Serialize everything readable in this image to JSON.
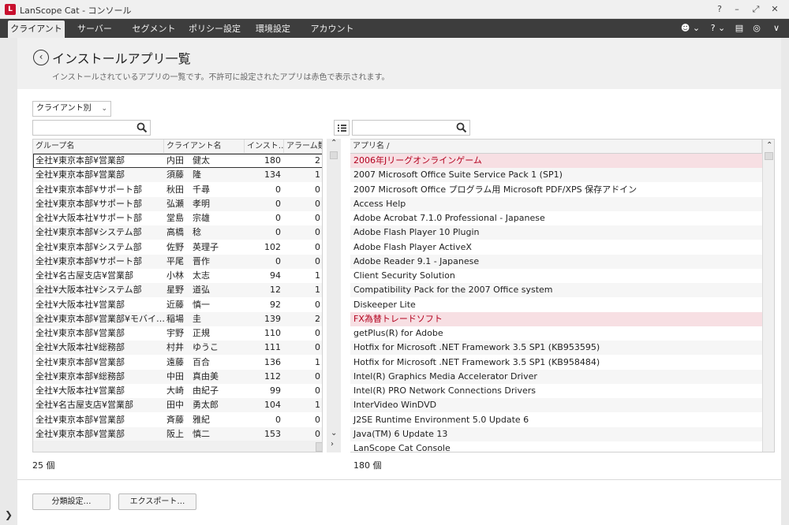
{
  "window": {
    "title": "LanScope Cat - コンソール",
    "icon_label": "L",
    "controls": [
      "?",
      "–",
      "⤢",
      "✕"
    ]
  },
  "nav": {
    "tabs": [
      "クライアント",
      "サーバー",
      "セグメント",
      "ポリシー設定",
      "環境設定",
      "アカウント"
    ],
    "active_tab": "クライアント",
    "right_icons": {
      "user": "☻ ⌄",
      "help": "? ⌄",
      "list": "▤",
      "globe": "◎",
      "menu": "∨"
    }
  },
  "page": {
    "title": "インストールアプリ一覧",
    "subtitle": "インストールされているアプリの一覧です。不許可に設定されたアプリは赤色で表示されます。",
    "back_icon": "‹"
  },
  "filter": {
    "selected": "クライアント別",
    "chevron": "⌄"
  },
  "left_search": {
    "placeholder": ""
  },
  "right_search": {
    "placeholder": ""
  },
  "client_table": {
    "headers": [
      "グループ名",
      "クライアント名",
      "インスト…",
      "アラーム数"
    ],
    "rows": [
      [
        "全社¥東京本部¥営業部",
        "内田　健太",
        "180",
        "2"
      ],
      [
        "全社¥東京本部¥営業部",
        "須藤　隆",
        "134",
        "1"
      ],
      [
        "全社¥東京本部¥サポート部",
        "秋田　千尋",
        "0",
        "0"
      ],
      [
        "全社¥東京本部¥サポート部",
        "弘瀬　孝明",
        "0",
        "0"
      ],
      [
        "全社¥大阪本社¥サポート部",
        "堂島　宗雄",
        "0",
        "0"
      ],
      [
        "全社¥東京本部¥システム部",
        "高橋　稔",
        "0",
        "0"
      ],
      [
        "全社¥東京本部¥システム部",
        "佐野　英理子",
        "102",
        "0"
      ],
      [
        "全社¥東京本部¥サポート部",
        "平尾　晋作",
        "0",
        "0"
      ],
      [
        "全社¥名古屋支店¥営業部",
        "小林　太志",
        "94",
        "1"
      ],
      [
        "全社¥大阪本社¥システム部",
        "星野　道弘",
        "12",
        "1"
      ],
      [
        "全社¥大阪本社¥営業部",
        "近藤　慎一",
        "92",
        "0"
      ],
      [
        "全社¥東京本部¥営業部¥モバイ…",
        "稲場　圭",
        "139",
        "2"
      ],
      [
        "全社¥東京本部¥営業部",
        "宇野　正規",
        "110",
        "0"
      ],
      [
        "全社¥大阪本社¥総務部",
        "村井　ゆうこ",
        "111",
        "0"
      ],
      [
        "全社¥東京本部¥営業部",
        "遠藤　百合",
        "136",
        "1"
      ],
      [
        "全社¥東京本部¥総務部",
        "中田　真由美",
        "112",
        "0"
      ],
      [
        "全社¥大阪本社¥営業部",
        "大崎　由紀子",
        "99",
        "0"
      ],
      [
        "全社¥名古屋支店¥営業部",
        "田中　勇太郎",
        "104",
        "1"
      ],
      [
        "全社¥東京本部¥営業部",
        "斉藤　雅紀",
        "0",
        "0"
      ],
      [
        "全社¥東京本部¥営業部",
        "阪上　慎二",
        "153",
        "0"
      ]
    ],
    "count": "25 個"
  },
  "app_table": {
    "header": "アプリ名 /",
    "rows": [
      {
        "name": "2006年Jリーグオンラインゲーム",
        "denied": true
      },
      {
        "name": "2007 Microsoft Office Suite Service Pack 1 (SP1)",
        "denied": false
      },
      {
        "name": "2007 Microsoft Office プログラム用 Microsoft PDF/XPS 保存アドイン",
        "denied": false
      },
      {
        "name": "Access Help",
        "denied": false
      },
      {
        "name": "Adobe Acrobat 7.1.0 Professional - Japanese",
        "denied": false
      },
      {
        "name": "Adobe Flash Player 10 Plugin",
        "denied": false
      },
      {
        "name": "Adobe Flash Player ActiveX",
        "denied": false
      },
      {
        "name": "Adobe Reader 9.1 - Japanese",
        "denied": false
      },
      {
        "name": "Client Security Solution",
        "denied": false
      },
      {
        "name": "Compatibility Pack for the 2007 Office system",
        "denied": false
      },
      {
        "name": "Diskeeper Lite",
        "denied": false
      },
      {
        "name": "FX為替トレードソフト",
        "denied": true
      },
      {
        "name": "getPlus(R) for Adobe",
        "denied": false
      },
      {
        "name": "Hotfix for Microsoft .NET Framework 3.5 SP1 (KB953595)",
        "denied": false
      },
      {
        "name": "Hotfix for Microsoft .NET Framework 3.5 SP1 (KB958484)",
        "denied": false
      },
      {
        "name": "Intel(R) Graphics Media Accelerator Driver",
        "denied": false
      },
      {
        "name": "Intel(R) PRO Network Connections Drivers",
        "denied": false
      },
      {
        "name": "InterVideo WinDVD",
        "denied": false
      },
      {
        "name": "J2SE Runtime Environment 5.0 Update 6",
        "denied": false
      },
      {
        "name": "Java(TM) 6 Update 13",
        "denied": false
      },
      {
        "name": "LanScope Cat Console",
        "denied": false
      }
    ],
    "count": "180 個"
  },
  "buttons": {
    "category": "分類設定…",
    "export": "エクスポート…"
  },
  "colors": {
    "denied_bg": "#f7dfe3",
    "denied_text": "#b3001e",
    "navbar": "#3d3d3d"
  }
}
